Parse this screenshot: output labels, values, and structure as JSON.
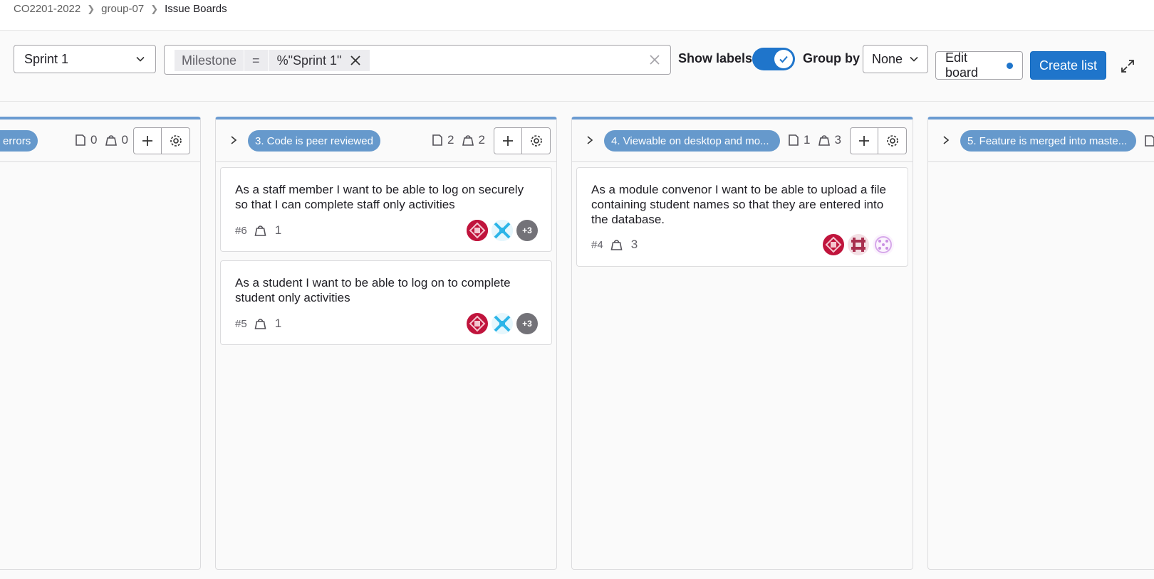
{
  "breadcrumb": {
    "items": [
      "CO2201-2022",
      "group-07"
    ],
    "current": "Issue Boards"
  },
  "toolbar": {
    "milestone_select": "Sprint 1",
    "filter": {
      "field": "Milestone",
      "operator": "=",
      "value": "%\"Sprint 1\""
    },
    "show_labels": "Show labels",
    "group_by_label": "Group by",
    "group_by_value": "None",
    "edit_board": "Edit board",
    "create_list": "Create list"
  },
  "lists": [
    {
      "title": "out errors",
      "issues_count": "0",
      "weight": "0",
      "cards": []
    },
    {
      "title": "3. Code is peer reviewed",
      "issues_count": "2",
      "weight": "2",
      "cards": [
        {
          "title": "As a staff member I want to be able to log on securely so that I can complete staff only activities",
          "number": "#6",
          "weight": "1",
          "more": "+3"
        },
        {
          "title": "As a student I want to be able to log on to complete student only activities",
          "number": "#5",
          "weight": "1",
          "more": "+3"
        }
      ]
    },
    {
      "title": "4. Viewable on desktop and mo...",
      "issues_count": "1",
      "weight": "3",
      "cards": [
        {
          "title": "As a module convenor I want to be able to upload a file containing student names so that they are entered into the database.",
          "number": "#4",
          "weight": "3"
        }
      ]
    },
    {
      "title": "5. Feature is merged into maste...",
      "cards": []
    }
  ],
  "colors": {
    "accent": "#1f75cb",
    "label": "#6699cc"
  }
}
